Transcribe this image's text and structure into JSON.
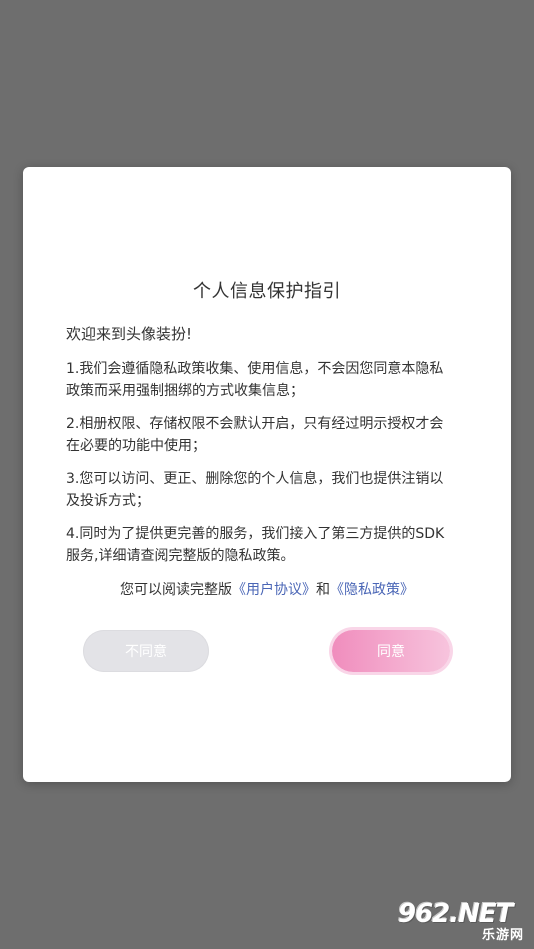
{
  "dialog": {
    "title": "个人信息保护指引",
    "welcome": "欢迎来到头像装扮!",
    "items": [
      "1.我们会遵循隐私政策收集、使用信息，不会因您同意本隐私政策而采用强制捆绑的方式收集信息；",
      "2.相册权限、存储权限不会默认开启，只有经过明示授权才会在必要的功能中使用；",
      "3.您可以访问、更正、删除您的个人信息，我们也提供注销以及投诉方式；",
      "4.同时为了提供更完善的服务，我们接入了第三方提供的SDK服务,详细请查阅完整版的隐私政策。"
    ],
    "read_prefix": "您可以阅读完整版",
    "user_agreement_link": "《用户协议》",
    "read_and": "和",
    "privacy_policy_link": "《隐私政策》",
    "disagree_label": "不同意",
    "agree_label": "同意"
  },
  "watermark": {
    "top": "962.NET",
    "bottom": "乐游网"
  },
  "colors": {
    "overlay": "#6e6e6e",
    "link": "#4a66b6",
    "agree_start": "#f08dbd",
    "agree_end": "#f7c4dd",
    "disagree": "#e3e3e7"
  }
}
